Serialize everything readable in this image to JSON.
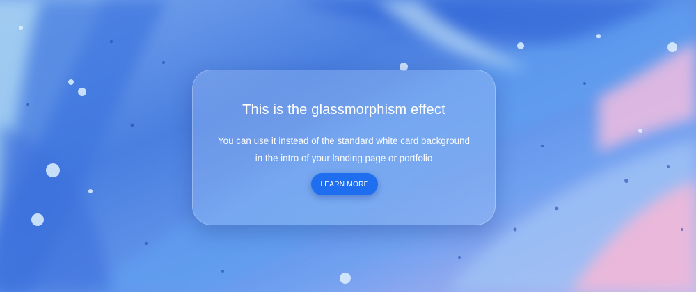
{
  "card": {
    "title": "This is the glassmorphism effect",
    "body_line_1": "You can use it instead of the standard white card background",
    "body_line_2": "in the intro of your landing page or portfolio",
    "button_label": "LEARN MORE"
  },
  "colors": {
    "button": "#1f6ef0",
    "card_text": "#ffffff",
    "background_primary": "#4a7fe0",
    "background_accent": "#f2b8d8"
  }
}
